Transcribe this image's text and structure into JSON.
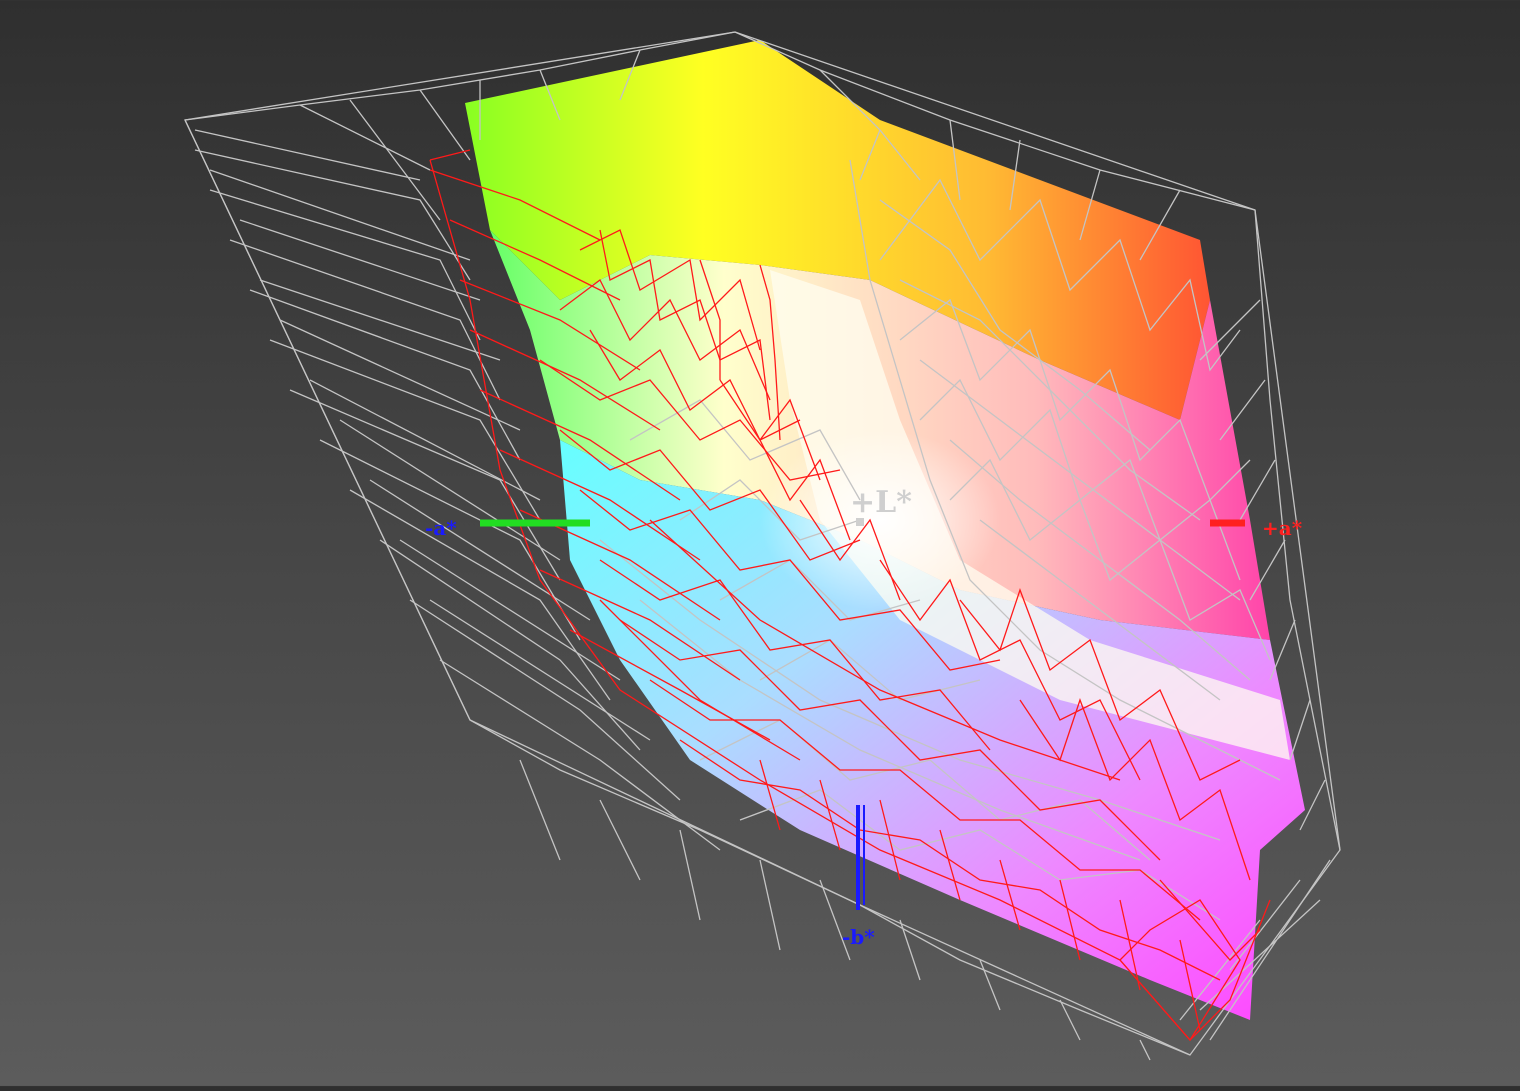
{
  "viewer": {
    "axes": {
      "plus_L": "+L*",
      "minus_a": "-a*",
      "plus_a": "+a*",
      "minus_b": "-b*"
    },
    "colors": {
      "background_top": "#2f2f2f",
      "background_bottom": "#5c5c5c",
      "wireframe_outer": "#c4c4c4",
      "wireframe_inner": "#ff1a1a",
      "axis_a_negative": "#22dd22",
      "axis_a_positive": "#ff2020",
      "axis_b_negative": "#1a1aff",
      "axis_L": "#cfcfcf"
    }
  }
}
